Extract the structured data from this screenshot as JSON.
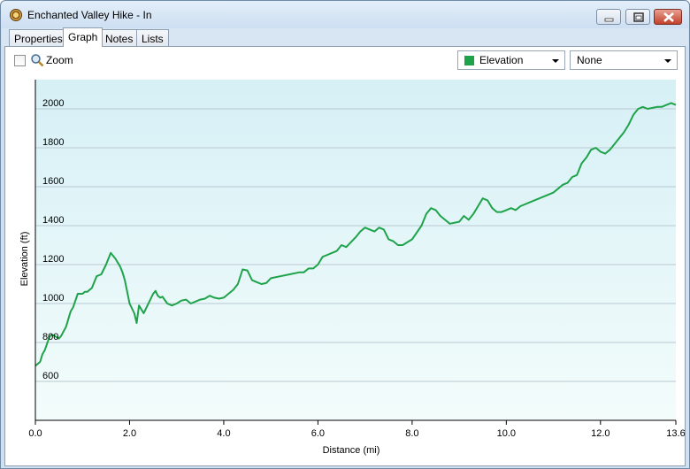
{
  "window": {
    "title": "Enchanted Valley Hike - In"
  },
  "tabs": [
    {
      "label": "Properties",
      "active": false
    },
    {
      "label": "Graph",
      "active": true
    },
    {
      "label": "Notes",
      "active": false
    },
    {
      "label": "Lists",
      "active": false
    }
  ],
  "toolbar": {
    "zoom_label": "Zoom",
    "zoom_checked": false,
    "y_series_select": "Elevation",
    "y_series_color": "#1fa34a",
    "secondary_select": "None"
  },
  "chart_data": {
    "type": "area",
    "title": "",
    "xlabel": "Distance  (mi)",
    "ylabel": "Elevation (ft)",
    "xlim": [
      0,
      13.6
    ],
    "ylim": [
      400,
      2150
    ],
    "x_ticks": [
      "0.0",
      "2.0",
      "4.0",
      "6.0",
      "8.0",
      "10.0",
      "12.0",
      "13.6"
    ],
    "y_ticks": [
      "600",
      "800",
      "1000",
      "1200",
      "1400",
      "1600",
      "1800",
      "2000"
    ],
    "grid": true,
    "line_color": "#1fa34a",
    "series": [
      {
        "name": "Elevation",
        "x": [
          0.0,
          0.1,
          0.15,
          0.2,
          0.3,
          0.35,
          0.4,
          0.5,
          0.55,
          0.65,
          0.75,
          0.8,
          0.9,
          1.0,
          1.05,
          1.1,
          1.2,
          1.3,
          1.4,
          1.5,
          1.6,
          1.7,
          1.8,
          1.85,
          1.9,
          2.0,
          2.1,
          2.15,
          2.2,
          2.3,
          2.4,
          2.5,
          2.55,
          2.6,
          2.65,
          2.7,
          2.8,
          2.9,
          3.0,
          3.1,
          3.2,
          3.3,
          3.4,
          3.5,
          3.6,
          3.7,
          3.8,
          3.9,
          4.0,
          4.2,
          4.3,
          4.4,
          4.5,
          4.6,
          4.7,
          4.8,
          4.9,
          5.0,
          5.2,
          5.4,
          5.6,
          5.7,
          5.8,
          5.9,
          6.0,
          6.1,
          6.2,
          6.3,
          6.4,
          6.5,
          6.6,
          6.8,
          6.9,
          7.0,
          7.1,
          7.2,
          7.3,
          7.4,
          7.5,
          7.6,
          7.7,
          7.8,
          8.0,
          8.2,
          8.3,
          8.4,
          8.5,
          8.6,
          8.7,
          8.8,
          9.0,
          9.1,
          9.2,
          9.3,
          9.4,
          9.5,
          9.6,
          9.7,
          9.8,
          9.9,
          10.0,
          10.1,
          10.2,
          10.3,
          10.5,
          10.7,
          10.9,
          11.0,
          11.1,
          11.2,
          11.3,
          11.4,
          11.5,
          11.6,
          11.7,
          11.8,
          11.9,
          12.0,
          12.1,
          12.2,
          12.3,
          12.4,
          12.5,
          12.6,
          12.7,
          12.8,
          12.9,
          13.0,
          13.2,
          13.3,
          13.4,
          13.5,
          13.6
        ],
        "values": [
          680,
          700,
          740,
          760,
          830,
          840,
          835,
          820,
          835,
          880,
          960,
          980,
          1050,
          1050,
          1060,
          1060,
          1080,
          1140,
          1150,
          1200,
          1260,
          1230,
          1190,
          1160,
          1120,
          1000,
          950,
          900,
          990,
          950,
          1000,
          1050,
          1065,
          1040,
          1030,
          1035,
          1000,
          990,
          1000,
          1015,
          1020,
          1000,
          1010,
          1020,
          1025,
          1040,
          1030,
          1025,
          1030,
          1070,
          1100,
          1175,
          1170,
          1120,
          1110,
          1100,
          1105,
          1130,
          1140,
          1150,
          1160,
          1160,
          1180,
          1180,
          1200,
          1240,
          1250,
          1260,
          1270,
          1300,
          1290,
          1340,
          1370,
          1390,
          1380,
          1370,
          1390,
          1380,
          1330,
          1320,
          1300,
          1300,
          1330,
          1400,
          1460,
          1490,
          1480,
          1450,
          1430,
          1410,
          1420,
          1450,
          1430,
          1460,
          1500,
          1540,
          1530,
          1490,
          1470,
          1470,
          1480,
          1490,
          1480,
          1500,
          1520,
          1540,
          1560,
          1570,
          1590,
          1610,
          1620,
          1650,
          1660,
          1720,
          1750,
          1790,
          1800,
          1780,
          1770,
          1790,
          1820,
          1850,
          1880,
          1920,
          1970,
          2000,
          2010,
          2000,
          2010,
          2010,
          2020,
          2030,
          2020
        ]
      }
    ]
  }
}
